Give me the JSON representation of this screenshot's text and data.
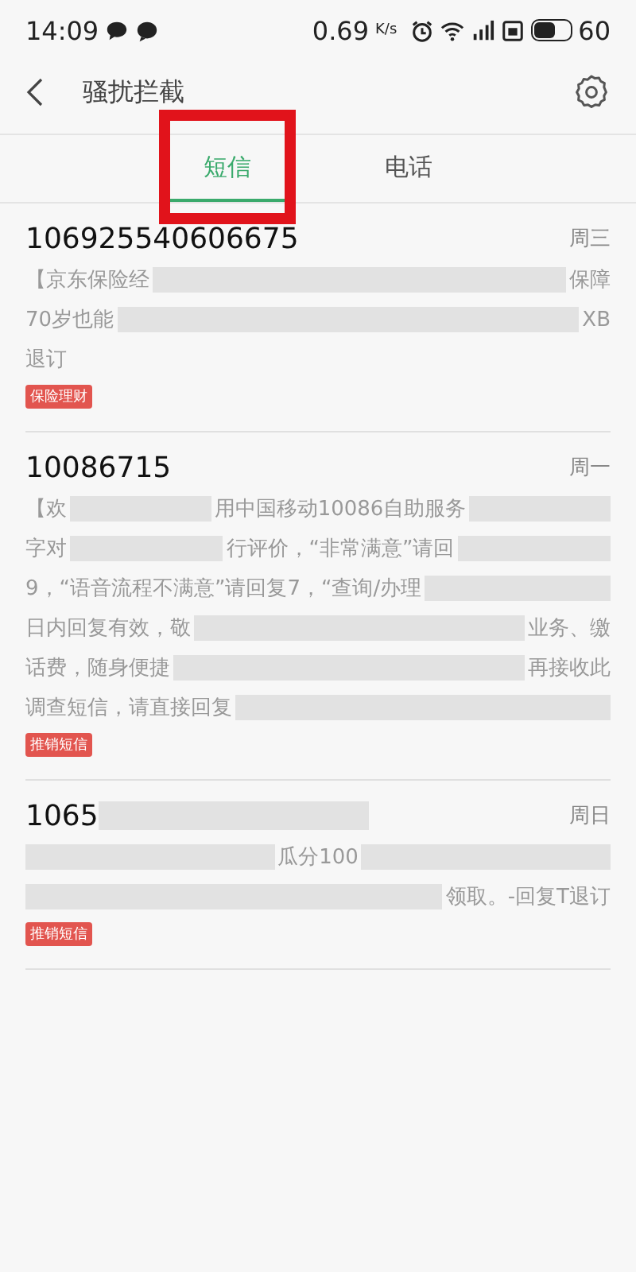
{
  "status_bar": {
    "time": "14:09",
    "speed": "0.69",
    "speed_unit": "K/s",
    "battery": "60"
  },
  "header": {
    "title": "骚扰拦截"
  },
  "tabs": [
    {
      "label": "短信",
      "selected": true,
      "highlighted": true
    },
    {
      "label": "电话",
      "selected": false,
      "highlighted": false
    }
  ],
  "messages": [
    {
      "sender": [
        {
          "kind": "text",
          "text": "106925540606675"
        }
      ],
      "day": "周三",
      "tag": "保险理财",
      "lines": [
        [
          {
            "kind": "text",
            "text": "【京东保险经"
          },
          {
            "kind": "blur"
          },
          {
            "kind": "text",
            "text": "保障"
          }
        ],
        [
          {
            "kind": "text",
            "text": "70岁也能"
          },
          {
            "kind": "blur"
          },
          {
            "kind": "text",
            "text": "XB"
          }
        ],
        [
          {
            "kind": "text",
            "text": "退订"
          }
        ]
      ]
    },
    {
      "sender": [
        {
          "kind": "text",
          "text": "10086715"
        }
      ],
      "day": "周一",
      "tag": "推销短信",
      "lines": [
        [
          {
            "kind": "text",
            "text": "【欢"
          },
          {
            "kind": "blur"
          },
          {
            "kind": "text",
            "text": "用中国移动10086自助服务"
          },
          {
            "kind": "blur"
          }
        ],
        [
          {
            "kind": "text",
            "text": "字对"
          },
          {
            "kind": "blur"
          },
          {
            "kind": "text",
            "text": "行评价，“非常满意”请回"
          },
          {
            "kind": "blur"
          }
        ],
        [
          {
            "kind": "text",
            "text": "9，“语音流程不满意”请回复7，“查询/办理"
          },
          {
            "kind": "blur"
          }
        ],
        [
          {
            "kind": "text",
            "text": "日内回复有效，敬"
          },
          {
            "kind": "blur"
          },
          {
            "kind": "text",
            "text": "业务、缴"
          }
        ],
        [
          {
            "kind": "text",
            "text": "话费，随身便捷"
          },
          {
            "kind": "blur"
          },
          {
            "kind": "text",
            "text": "再接收此"
          }
        ],
        [
          {
            "kind": "text",
            "text": "调查短信，请直接回复"
          },
          {
            "kind": "blur"
          }
        ]
      ]
    },
    {
      "sender": [
        {
          "kind": "text",
          "text": "1065"
        },
        {
          "kind": "blur"
        }
      ],
      "day": "周日",
      "tag": "推销短信",
      "lines": [
        [
          {
            "kind": "blur"
          },
          {
            "kind": "text",
            "text": "瓜分100"
          },
          {
            "kind": "blur"
          }
        ],
        [
          {
            "kind": "blur"
          },
          {
            "kind": "text",
            "text": "领取。-回复T退订"
          }
        ]
      ]
    }
  ]
}
